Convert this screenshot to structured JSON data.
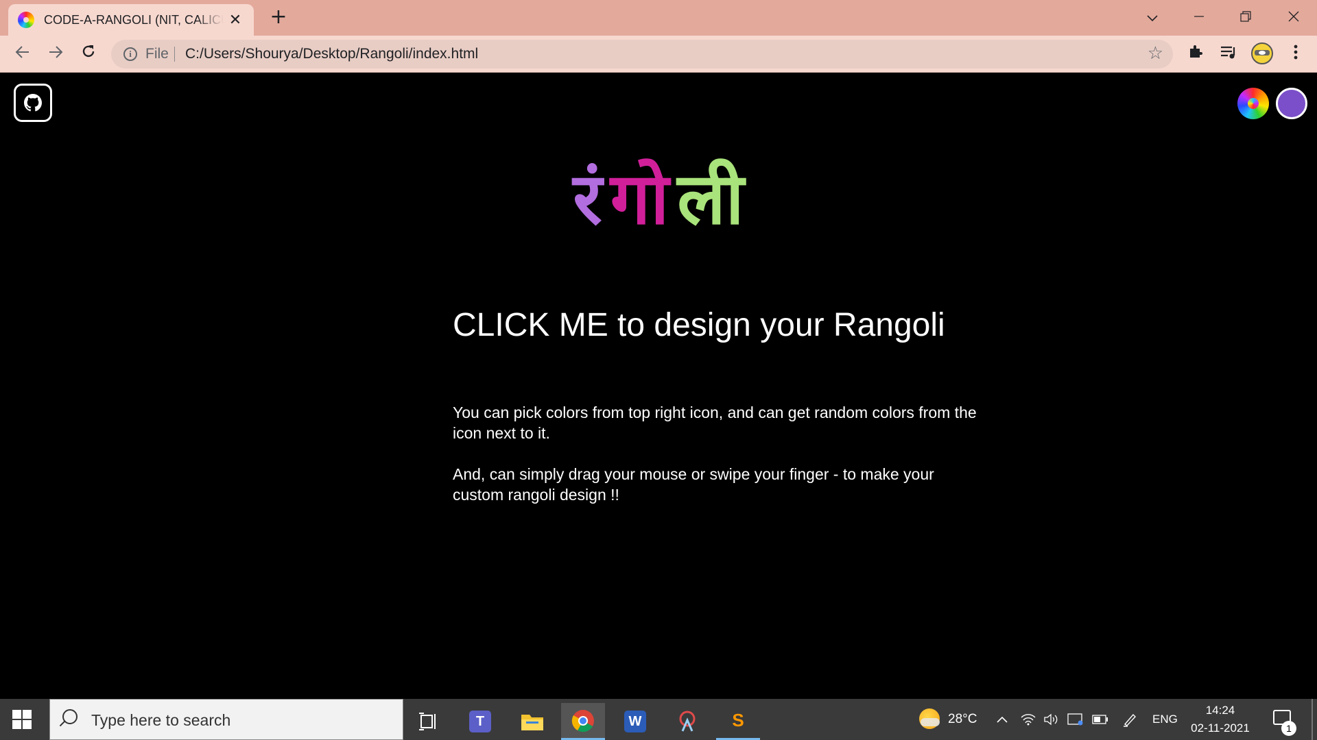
{
  "browser": {
    "tab_title": "CODE-A-RANGOLI (NIT, CALICUT)",
    "tab_close": "✕",
    "new_tab": "+",
    "scheme": "File",
    "url": "C:/Users/Shourya/Desktop/Rangoli/index.html"
  },
  "page": {
    "title_parts": [
      "रं",
      "गो",
      "ली"
    ],
    "title_colors": [
      "#b26ddf",
      "#d11f9a",
      "#a9e37b"
    ],
    "cta": "CLICK ME to design your Rangoli",
    "desc1": "You can pick colors from top right icon, and can get random colors from the icon next to it.",
    "desc2": "And, can simply drag your mouse or swipe your finger - to make your custom rangoli design !!",
    "random_color": "#7b4fc9"
  },
  "taskbar": {
    "search_placeholder": "Type here to search",
    "weather": "28°C",
    "language": "ENG",
    "time": "14:24",
    "date": "02-11-2021",
    "notifications": "1"
  }
}
